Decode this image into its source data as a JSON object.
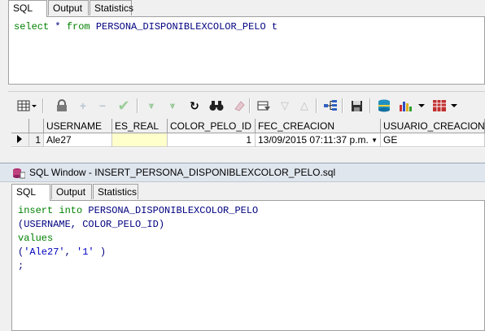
{
  "top_tabs": [
    {
      "label": "SQL",
      "active": true
    },
    {
      "label": "Output",
      "active": false
    },
    {
      "label": "Statistics",
      "active": false
    }
  ],
  "top_editor": {
    "line1": {
      "kw1": "select",
      "op": " * ",
      "kw2": "from",
      "ident": " PERSONA_DISPONIBLEXCOLOR_PELO t"
    }
  },
  "grid": {
    "columns": [
      "USERNAME",
      "ES_REAL",
      "COLOR_PELO_ID",
      "FEC_CREACION",
      "USUARIO_CREACION"
    ],
    "rows": [
      {
        "num": "1",
        "username": "Ale27",
        "es_real": "",
        "color_pelo_id": "1",
        "fec_creacion": "13/09/2015 07:11:37 p.m.",
        "usuario_creacion": "GE"
      }
    ]
  },
  "window": {
    "title": "SQL Window - INSERT_PERSONA_DISPONIBLEXCOLOR_PELO.sql"
  },
  "bottom_tabs": [
    {
      "label": "SQL",
      "active": true
    },
    {
      "label": "Output",
      "active": false
    },
    {
      "label": "Statistics",
      "active": false
    }
  ],
  "bottom_editor": {
    "l1_kw": "insert into",
    "l1_id": " PERSONA_DISPONIBLEXCOLOR_PELO",
    "l2": "(USERNAME, COLOR_PELO_ID)",
    "l3_kw": "values",
    "l4_open": "(",
    "l4_s1": "'Ale27'",
    "l4_comma": ", ",
    "l4_s2": "'1'",
    "l4_close": " )",
    "l5": ";"
  },
  "colors": {
    "keyword": "#008000",
    "identifier": "#000080",
    "string": "#0000c0",
    "highlight_cell": "#ffffcc"
  }
}
